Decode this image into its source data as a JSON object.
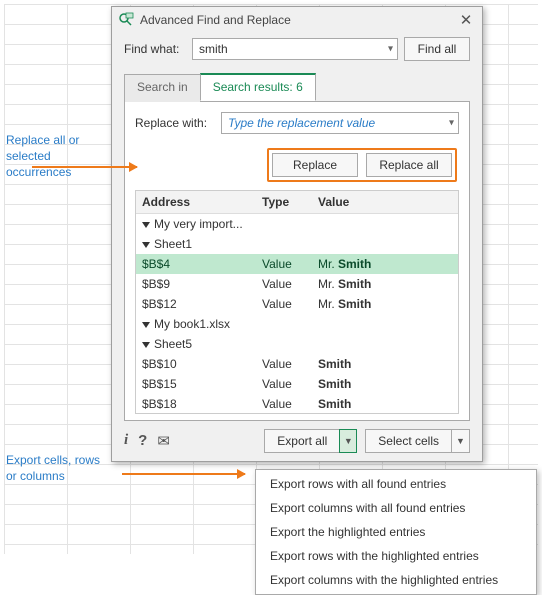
{
  "dialog": {
    "title": "Advanced Find and Replace",
    "find_what_label": "Find what:",
    "find_value": "smith",
    "find_all_label": "Find all",
    "tabs": {
      "search_in": "Search in",
      "search_results": "Search results: 6"
    },
    "replace_with_label": "Replace with:",
    "replace_placeholder": "Type the replacement value",
    "replace_btn": "Replace",
    "replace_all_btn": "Replace all",
    "columns": {
      "address": "Address",
      "type": "Type",
      "value": "Value"
    },
    "tree": [
      {
        "level": 0,
        "label": "My very import..."
      },
      {
        "level": 1,
        "label": "Sheet1"
      },
      {
        "level": 2,
        "addr": "$B$4",
        "type": "Value",
        "prefix": "Mr. ",
        "match": "Smith",
        "selected": true
      },
      {
        "level": 2,
        "addr": "$B$9",
        "type": "Value",
        "prefix": "Mr. ",
        "match": "Smith"
      },
      {
        "level": 2,
        "addr": "$B$12",
        "type": "Value",
        "prefix": "Mr. ",
        "match": "Smith"
      },
      {
        "level": 0,
        "label": "My book1.xlsx"
      },
      {
        "level": 1,
        "label": "Sheet5"
      },
      {
        "level": 2,
        "addr": "$B$10",
        "type": "Value",
        "prefix": "",
        "match": "Smith"
      },
      {
        "level": 2,
        "addr": "$B$15",
        "type": "Value",
        "prefix": "",
        "match": "Smith"
      },
      {
        "level": 2,
        "addr": "$B$18",
        "type": "Value",
        "prefix": "",
        "match": "Smith"
      }
    ],
    "export_all": "Export all",
    "select_cells": "Select cells",
    "footer_icons": {
      "info": "i",
      "help": "?",
      "mail": "✉"
    }
  },
  "menu": {
    "items": [
      "Export rows with all found entries",
      "Export columns with all found entries",
      "Export the highlighted entries",
      "Export rows with the highlighted entries",
      "Export columns with the highlighted entries"
    ]
  },
  "callouts": {
    "replace": "Replace all or\nselected occurrences",
    "export": "Export cells, rows\nor columns"
  }
}
